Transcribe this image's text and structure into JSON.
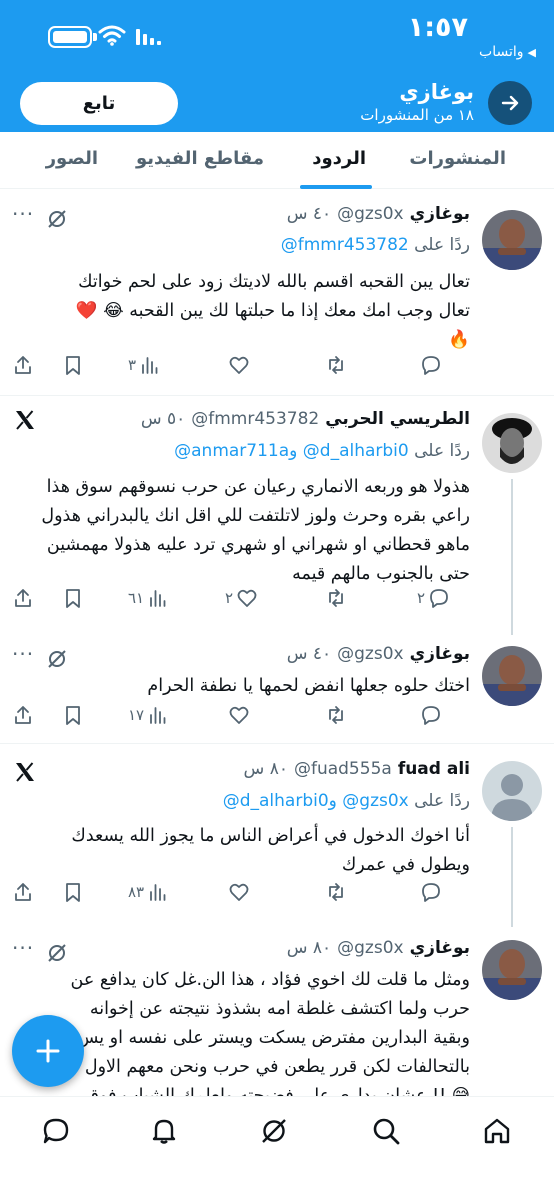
{
  "status_bar": {
    "time": "١:٥٧",
    "back_app": "واتساب"
  },
  "header": {
    "profile_name": "بوغازي",
    "post_count": "١٨ من المنشورات",
    "follow_label": "تابع"
  },
  "tabs": [
    {
      "label": "المنشورات",
      "active": false
    },
    {
      "label": "الردود",
      "active": true
    },
    {
      "label": "مقاطع الفيديو",
      "active": false
    },
    {
      "label": "الصور",
      "active": false
    }
  ],
  "tweets": [
    {
      "name": "بوغازي",
      "handle": "@gzs0x",
      "time": "٤٠ س",
      "reply_prefix": "ردًا على",
      "reply_to": "@fmmr453782",
      "reply_joiner": "",
      "reply_to2": "",
      "text_lines": [
        "تعال يبن القحبه اقسم بالله لاديتك زود على لحم خواتك",
        "تعال وجب امك معك إذا ما حبلتها لك يبن القحبه 😂 ❤️",
        "🔥"
      ],
      "stats": {
        "replies": "",
        "retweets": "",
        "likes": "",
        "views": "٣"
      }
    },
    {
      "name": "الطريسي الحربي",
      "handle": "@fmmr453782",
      "time": "٥٠ س",
      "reply_prefix": "ردًا على",
      "reply_to": "@d_alharbi0",
      "reply_joiner": "و",
      "reply_to2": "@anmar711a",
      "text_lines": [
        "هذولا  هو وربعه الانماري رعيان عن حرب نسوقهم سوق هذا",
        "راعي بقره وحرث ولوز لاتلتفت للي اقل انك يالبدراني هذول",
        "ماهو قحطاني او شهراني او شهري ترد عليه هذولا مهمشين",
        "حتى بالجنوب مالهم قيمه"
      ],
      "stats": {
        "replies": "٢",
        "retweets": "",
        "likes": "٢",
        "views": "٦١"
      }
    },
    {
      "name": "بوغازي",
      "handle": "@gzs0x",
      "time": "٤٠ س",
      "reply_prefix": "",
      "reply_to": "",
      "reply_joiner": "",
      "reply_to2": "",
      "text_lines": [
        "اختك حلوه جعلها انفض لحمها يا نطفة الحرام"
      ],
      "stats": {
        "replies": "",
        "retweets": "",
        "likes": "",
        "views": "١٧"
      }
    },
    {
      "name": "fuad ali",
      "handle": "@fuad555a",
      "time": "٨٠ س",
      "reply_prefix": "ردًا على",
      "reply_to": "@gzs0x",
      "reply_joiner": "و",
      "reply_to2": "@d_alharbi0",
      "text_lines": [
        "أنا اخوك الدخول في أعراض الناس ما يجوز الله يسعدك",
        "ويطول في عمرك"
      ],
      "stats": {
        "replies": "",
        "retweets": "",
        "likes": "",
        "views": "٨٣"
      }
    },
    {
      "name": "بوغازي",
      "handle": "@gzs0x",
      "time": "٨٠ س",
      "reply_prefix": "",
      "reply_to": "",
      "reply_joiner": "",
      "reply_to2": "",
      "text_lines": [
        "ومثل ما قلت لك اخوي فؤاد ، هذا الن.غل كان يدافع عن",
        "حرب ولما اكتشف غلطة امه بشذوذ نتيجته عن إخوانه",
        "وبقية البدارين مفترض يسكت ويستر على نفسه او يس",
        "بالتحالفات لكن قرر يطعن في حرب ونحن معهم الاول",
        "😅 !! عشان يداري على فضيحته ولعلمك الشباب فوق"
      ],
      "stats": {
        "replies": "",
        "retweets": "",
        "likes": "",
        "views": ""
      }
    }
  ],
  "colors": {
    "accent": "#1d9bf0",
    "text": "#0f1419",
    "muted": "#536471"
  },
  "bottom_nav": [
    "home-icon",
    "search-icon",
    "grok-icon",
    "notifications-icon",
    "messages-icon"
  ]
}
